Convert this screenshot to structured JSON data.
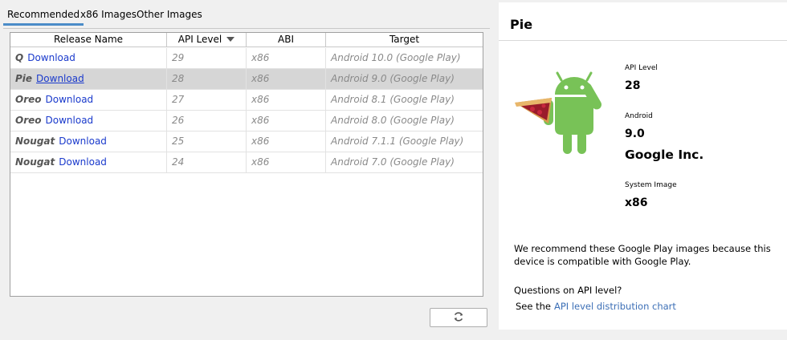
{
  "tabs": [
    {
      "label": "Recommended",
      "active": true
    },
    {
      "label": "x86 Images",
      "active": false
    },
    {
      "label": "Other Images",
      "active": false
    }
  ],
  "table": {
    "columns": [
      "Release Name",
      "API Level",
      "ABI",
      "Target"
    ],
    "sort_column": "API Level",
    "sort_direction": "descending",
    "rows": [
      {
        "name": "Q",
        "link": "Download",
        "api": "29",
        "abi": "x86",
        "target": "Android 10.0 (Google Play)",
        "selected": false
      },
      {
        "name": "Pie",
        "link": "Download",
        "api": "28",
        "abi": "x86",
        "target": "Android 9.0 (Google Play)",
        "selected": true
      },
      {
        "name": "Oreo",
        "link": "Download",
        "api": "27",
        "abi": "x86",
        "target": "Android 8.1 (Google Play)",
        "selected": false
      },
      {
        "name": "Oreo",
        "link": "Download",
        "api": "26",
        "abi": "x86",
        "target": "Android 8.0 (Google Play)",
        "selected": false
      },
      {
        "name": "Nougat",
        "link": "Download",
        "api": "25",
        "abi": "x86",
        "target": "Android 7.1.1 (Google Play)",
        "selected": false
      },
      {
        "name": "Nougat",
        "link": "Download",
        "api": "24",
        "abi": "x86",
        "target": "Android 7.0 (Google Play)",
        "selected": false
      }
    ]
  },
  "refresh_button": {
    "icon": "refresh-icon"
  },
  "details": {
    "title": "Pie",
    "api_label": "API Level",
    "api_value": "28",
    "android_label": "Android",
    "android_value": "9.0",
    "vendor": "Google Inc.",
    "system_image_label": "System Image",
    "system_image_value": "x86",
    "recommendation": "We recommend these Google Play images because this device is compatible with Google Play.",
    "question": "Questions on API level?",
    "see_prefix": "See the",
    "see_link": "API level distribution chart"
  },
  "colors": {
    "accent": "#4b8cc8",
    "link": "#1a3acc",
    "selected_row": "#d6d6d6",
    "android_green": "#78c257"
  }
}
